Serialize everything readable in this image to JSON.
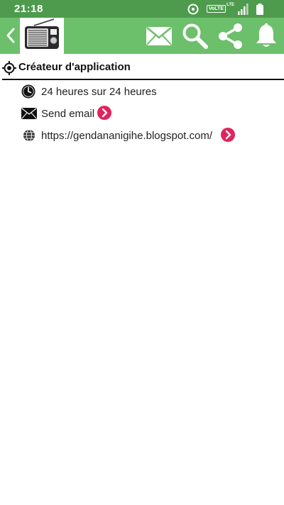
{
  "status_bar": {
    "time": "21:18",
    "volte": "VoLTE",
    "lte": "LTE",
    "icons": [
      "sync-icon",
      "signal-icon",
      "battery-icon"
    ]
  },
  "app_bar": {
    "icons": [
      "back-icon",
      "radio-logo",
      "mail-icon",
      "search-icon",
      "share-icon",
      "bell-icon"
    ],
    "accent_color": "#6cbf6b",
    "status_color": "#4e9b4e"
  },
  "section": {
    "title": "Créateur d'application"
  },
  "rows": [
    {
      "icon": "clock-icon",
      "text": "24 heures sur 24 heures"
    },
    {
      "icon": "envelope-icon",
      "text": "Send email"
    },
    {
      "icon": "globe-icon",
      "text": "https://gendananigihe.blogspot.com/"
    }
  ],
  "link_color": "#e0245e"
}
